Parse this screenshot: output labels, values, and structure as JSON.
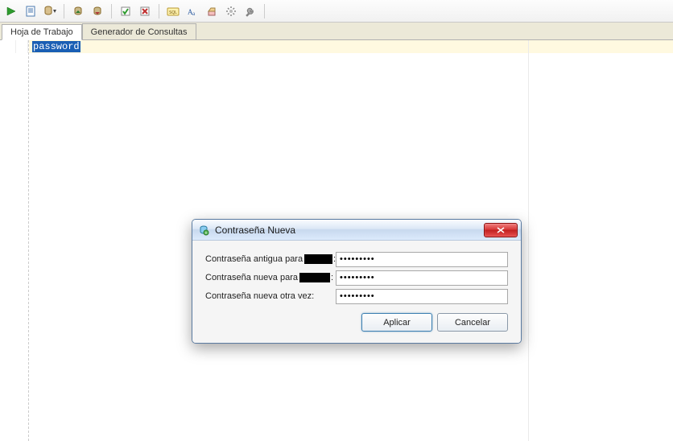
{
  "toolbar_icons": [
    "run-icon",
    "sheet-icon",
    "db-dropdown-icon",
    "sep",
    "import-icon",
    "export-icon",
    "sep",
    "commit-icon",
    "rollback-icon",
    "sep",
    "sql-icon",
    "font-icon",
    "clear-icon",
    "settings-icon",
    "wrench-icon",
    "sep"
  ],
  "tabs": {
    "worksheet": "Hoja de Trabajo",
    "query_builder": "Generador de Consultas"
  },
  "editor": {
    "selected_text": "password"
  },
  "dialog": {
    "title": "Contraseña Nueva",
    "row_old": "Contraseña antigua para",
    "row_new": "Contraseña nueva para",
    "row_repeat": "Contraseña nueva otra vez:",
    "value_old": "•••••••••",
    "value_new": "•••••••••",
    "value_repeat": "•••••••••",
    "apply": "Aplicar",
    "cancel": "Cancelar"
  }
}
